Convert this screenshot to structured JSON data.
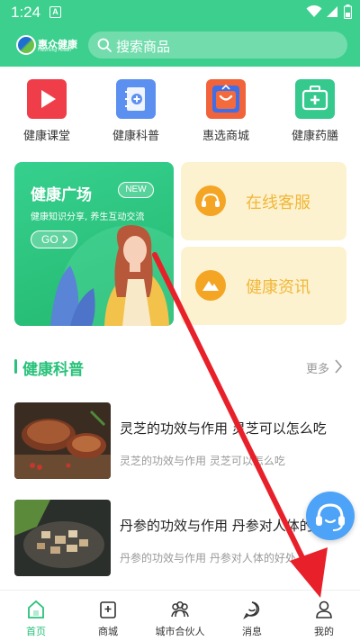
{
  "status_bar": {
    "time": "1:24",
    "badge": "A"
  },
  "header": {
    "logo_text": "惠众健康",
    "logo_subtext": "Huizhong Health",
    "search_placeholder": "搜索商品"
  },
  "categories": [
    {
      "label": "健康课堂",
      "icon": "play-icon",
      "color": "#ef3e4a"
    },
    {
      "label": "健康科普",
      "icon": "notebook-icon",
      "color": "#5b8ff0"
    },
    {
      "label": "惠选商城",
      "icon": "shopping-bag-icon",
      "color": "#f0633b"
    },
    {
      "label": "健康药膳",
      "icon": "medicine-kit-icon",
      "color": "#35c98e"
    }
  ],
  "promo": {
    "title": "健康广场",
    "badge": "NEW",
    "subtitle": "健康知识分享, 养生互动交流",
    "button": "GO"
  },
  "services": [
    {
      "label": "在线客服",
      "icon": "customer-service-icon"
    },
    {
      "label": "健康资讯",
      "icon": "mountain-icon"
    }
  ],
  "section": {
    "title": "健康科普",
    "more": "更多"
  },
  "articles": [
    {
      "title": "灵芝的功效与作用 灵芝可以怎么吃",
      "desc": "灵芝的功效与作用 灵芝可以怎么吃"
    },
    {
      "title": "丹参的功效与作用 丹参对人体的好处",
      "desc": "丹参的功效与作用 丹参对人体的好处"
    }
  ],
  "tabs": [
    {
      "label": "首页",
      "icon": "home-icon",
      "active": true
    },
    {
      "label": "商城",
      "icon": "store-icon",
      "active": false
    },
    {
      "label": "城市合伙人",
      "icon": "partners-icon",
      "active": false
    },
    {
      "label": "消息",
      "icon": "message-icon",
      "active": false
    },
    {
      "label": "我的",
      "icon": "profile-icon",
      "active": false
    }
  ],
  "colors": {
    "brand": "#3ccf8e",
    "accent": "#28c27a",
    "annotation": "#e8202a"
  }
}
